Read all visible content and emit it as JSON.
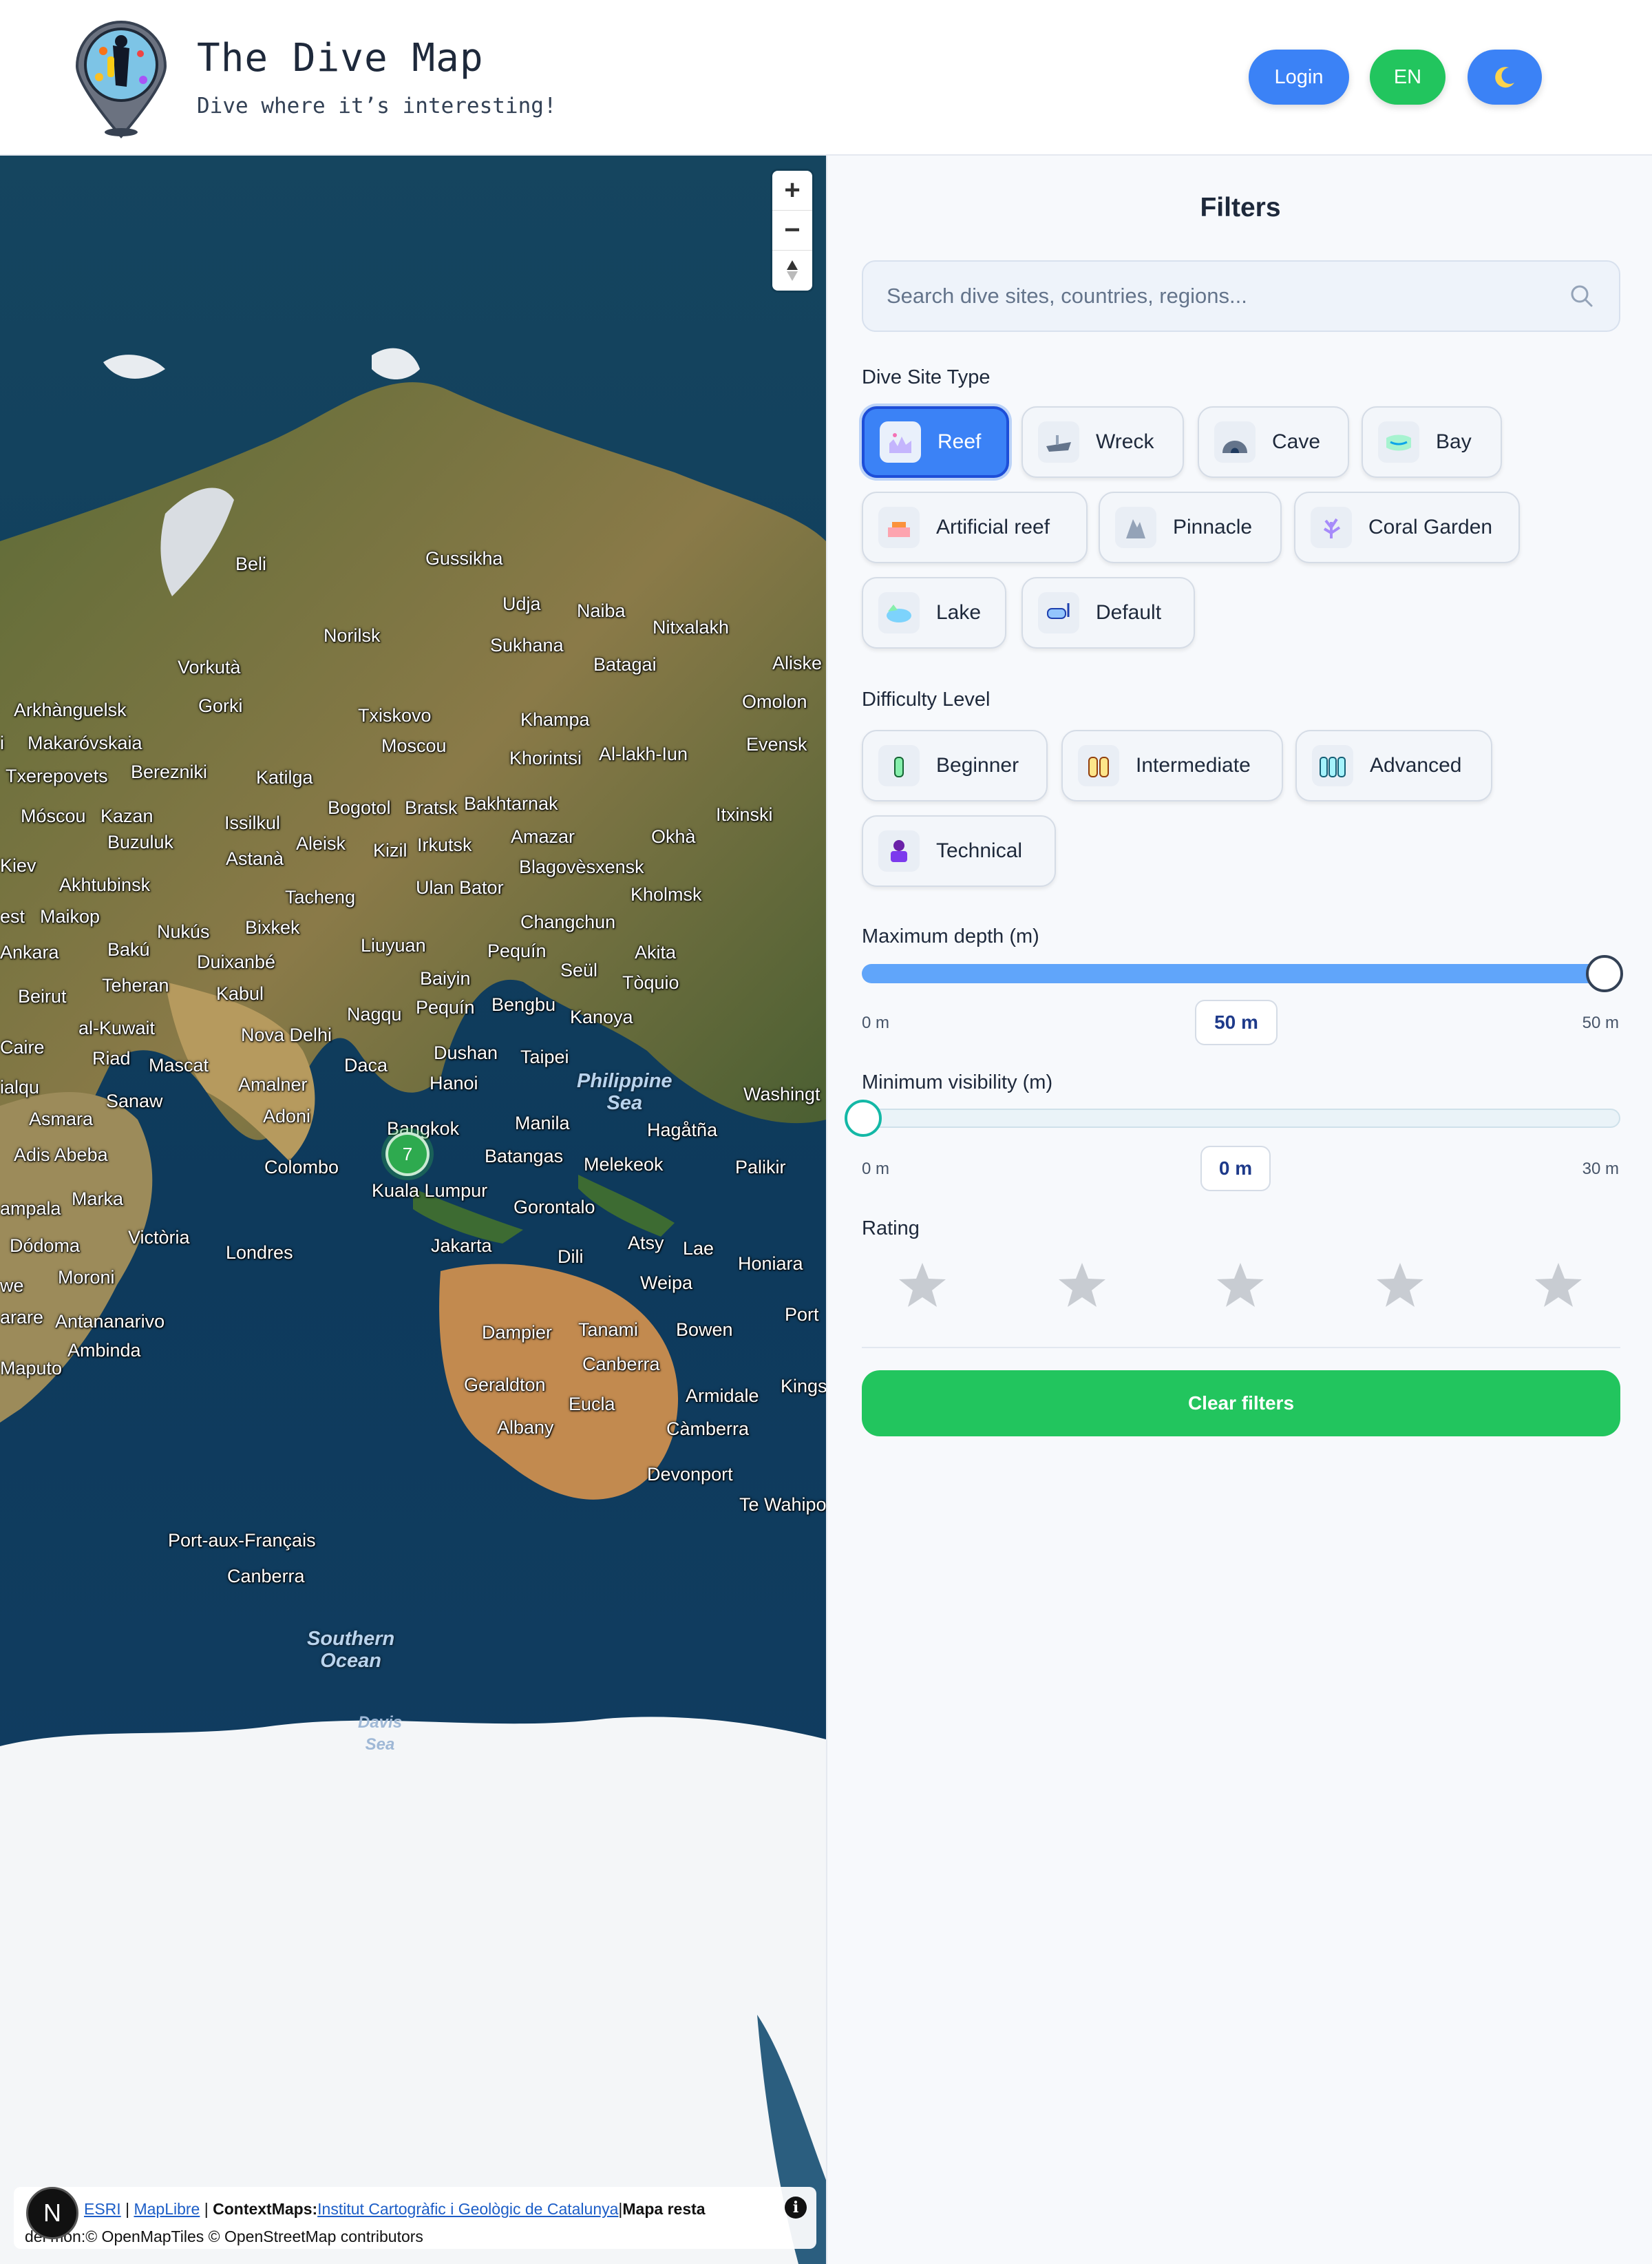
{
  "header": {
    "title": "The Dive Map",
    "tagline": "Dive where it’s interesting!",
    "login_label": "Login",
    "language_label": "EN",
    "theme_icon": "moon-icon",
    "colors": {
      "login": "#3b82f6",
      "language": "#22c55e",
      "theme": "#3b82f6"
    }
  },
  "map": {
    "zoom_in": "+",
    "zoom_out": "−",
    "compass": "▲",
    "cluster_count": "7",
    "labels": {
      "beli": "Beli",
      "gussikha": "Gussikha",
      "udja": "Udja",
      "naiba": "Naiba",
      "nitxalakh": "Nitxalakh",
      "norilsk": "Norilsk",
      "sukhana": "Sukhana",
      "batagai": "Batagai",
      "aliskerovo": "Aliske",
      "vorkuta": "Vorkutà",
      "gorki": "Gorki",
      "arkhanguelsk": "Arkhànguelsk",
      "omolon": "Omolon",
      "txiskovo": "Txiskovo",
      "khampa": "Khampa",
      "makarovskaia": "Makaróvskaia",
      "moscou_n": "Moscou",
      "khorintsi": "Khorintsi",
      "alakh": "Al-lakh-Iun",
      "evensk": "Evensk",
      "txerepovets": "Txerepovets",
      "berezniki": "Berezniki",
      "katilga": "Katilga",
      "bogotol": "Bogotol",
      "bratsk": "Bratsk",
      "bakhtarnak": "Bakhtarnak",
      "itxinski": "Itxinski",
      "moscou": "Móscou",
      "kazan": "Kazan",
      "issilkul": "Issilkul",
      "amazar": "Amazar",
      "okha": "Okhà",
      "buzuluk": "Buzuluk",
      "aleisk": "Aleisk",
      "kizil": "Kizil",
      "irkutsk": "Irkutsk",
      "astana": "Astanà",
      "blagovesxensk": "Blagovèsxensk",
      "kiev": "Kiev",
      "akhtubinsk": "Akhtubinsk",
      "ulanbator": "Ulan Bator",
      "kholmsk": "Kholmsk",
      "tacheng": "Tacheng",
      "maikop": "Maikop",
      "bixkek": "Bixkek",
      "nukus": "Nukús",
      "changchun": "Changchun",
      "ankara": "Ankara",
      "baku": "Bakú",
      "liuyuan": "Liuyuan",
      "pequin": "Pequín",
      "akita": "Akita",
      "duixanbe": "Duixanbé",
      "seul": "Seül",
      "toquio": "Tòquio",
      "beirut": "Beirut",
      "teheran": "Teheran",
      "kabul": "Kabul",
      "baiyin": "Baiyin",
      "nagqu": "Nagqu",
      "pequin2": "Pequín",
      "bengbu": "Bengbu",
      "kanoya": "Kanoya",
      "alkuwait": "al-Kuwait",
      "novadelhi": "Nova Delhi",
      "caire": "Caire",
      "riad": "Riad",
      "mascat": "Mascat",
      "daca": "Daca",
      "dushan": "Dushan",
      "taipei": "Taipei",
      "amalner": "Amalner",
      "hanoi": "Hanoi",
      "washington": "Washingt",
      "philippine": "Philippine",
      "sea": "Sea",
      "asmara": "Asmara",
      "sanaw": "Sanaw",
      "adoni": "Adoni",
      "manila": "Manila",
      "hagatna": "Hagåtña",
      "bangkok": "Bangkok",
      "adisabeba": "Adis Abeba",
      "colombo": "Colombo",
      "batangas": "Batangas",
      "melekeok": "Melekeok",
      "palikir": "Palikir",
      "kampala": "ampala",
      "marka": "Marka",
      "kualalumpur": "Kuala Lumpur",
      "gorontalo": "Gorontalo",
      "dodoma": "Dódoma",
      "victoria": "Victòria",
      "londres": "Londres",
      "jakarta": "Jakarta",
      "atsy": "Atsy",
      "lae": "Lae",
      "dili": "Dili",
      "honiara": "Honiara",
      "moroni": "Moroni",
      "weipa": "Weipa",
      "antananarivo": "Antananarivo",
      "dampier": "Dampier",
      "tanami": "Tanami",
      "bowen": "Bowen",
      "ambinda": "Ambinda",
      "canberra": "Canberra",
      "maputo": "Maputo",
      "geraldton": "Geraldton",
      "eucla": "Eucla",
      "armidale": "Armidale",
      "albany": "Albany",
      "camberra": "Càmberra",
      "devonport": "Devonport",
      "tewhipo": "Te Wahipo",
      "portauxfrancais": "Port-aux-Français",
      "canberra2": "Canberra",
      "southern": "Southern",
      "ocean": "Ocean",
      "davis": "Davis",
      "davissea": "Sea",
      "port": "Port",
      "kings": "Kings",
      "harare": "arare",
      "we": "we",
      "kenyalabel": "ialqu",
      "est": "est",
      "i": "i"
    },
    "attribution": {
      "esri": "ESRI",
      "maplibre": "MapLibre",
      "contextmaps": "ContextMaps:",
      "icgc": "Institut Cartogràfic i Geològic de Catalunya",
      "mapa_resta": "Mapa resta",
      "line2": "del món:© OpenMapTiles © OpenStreetMap contributors",
      "separator": "|"
    },
    "n_badge": "N"
  },
  "filters": {
    "title": "Filters",
    "search_placeholder": "Search dive sites, countries, regions...",
    "site_type_label": "Dive Site Type",
    "site_types": [
      "Reef",
      "Wreck",
      "Cave",
      "Bay",
      "Artificial reef",
      "Pinnacle",
      "Coral Garden",
      "Lake",
      "Default"
    ],
    "selected_site_type": "Reef",
    "difficulty_label": "Difficulty Level",
    "difficulties": [
      "Beginner",
      "Intermediate",
      "Advanced",
      "Technical"
    ],
    "max_depth": {
      "label": "Maximum depth (m)",
      "min": "0 m",
      "max": "50 m",
      "value_label": "50 m",
      "value": 50,
      "range_max": 50
    },
    "min_visibility": {
      "label": "Minimum visibility (m)",
      "min": "0 m",
      "max": "30 m",
      "value_label": "0 m",
      "value": 0,
      "range_max": 30
    },
    "rating_label": "Rating",
    "rating_value": 0,
    "rating_max": 5,
    "clear_label": "Clear filters",
    "accent": "#3b82f6",
    "clear_color": "#22c55e"
  }
}
